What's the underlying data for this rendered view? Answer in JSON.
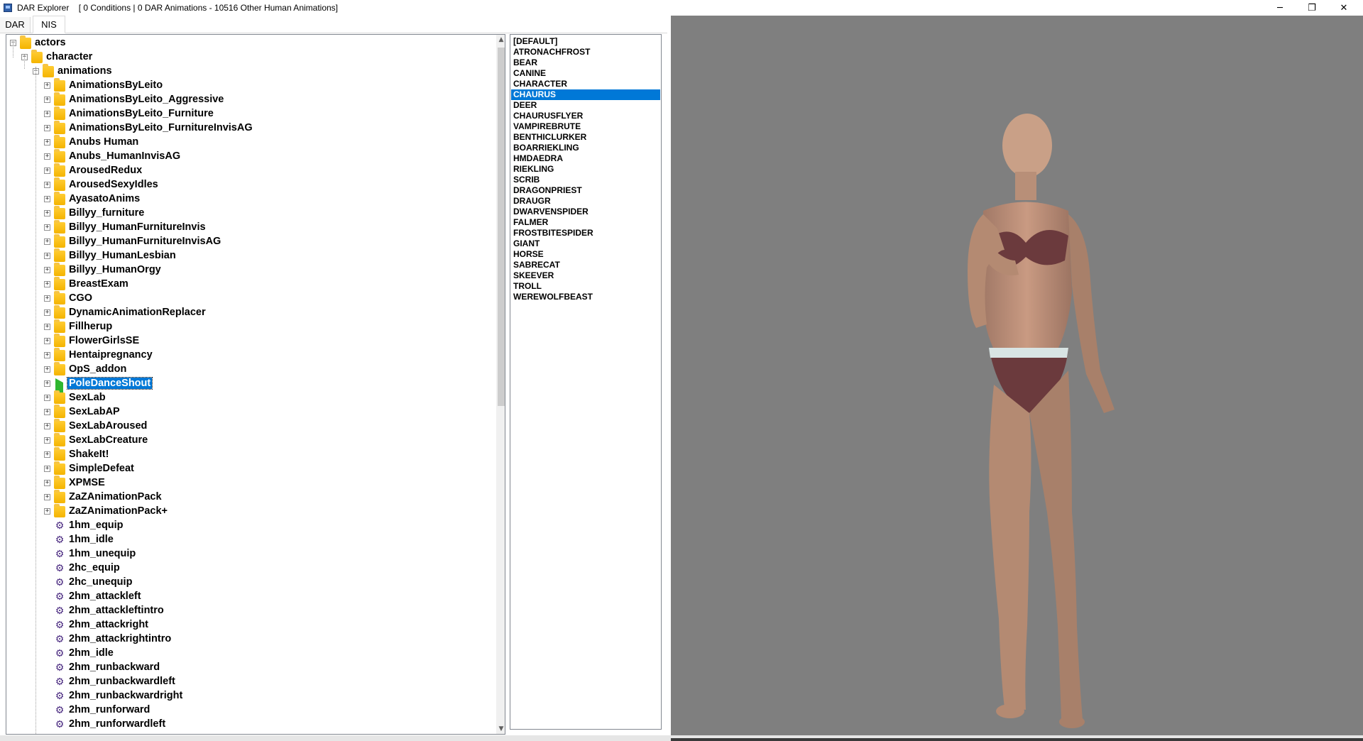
{
  "window": {
    "title": "DAR Explorer",
    "subtitle": "[ 0 Conditions | 0 DAR Animations - 10516 Other Human Animations]",
    "minimize": "─",
    "maximize": "❐",
    "close": "✕"
  },
  "tabs": {
    "dar": "DAR",
    "nis": "NIS"
  },
  "tree": {
    "root": "actors",
    "character": "character",
    "animations": "animations",
    "folders": [
      "AnimationsByLeito",
      "AnimationsByLeito_Aggressive",
      "AnimationsByLeito_Furniture",
      "AnimationsByLeito_FurnitureInvisAG",
      "Anubs Human",
      "Anubs_HumanInvisAG",
      "ArousedRedux",
      "ArousedSexyIdles",
      "AyasatoAnims",
      "Billyy_furniture",
      "Billyy_HumanFurnitureInvis",
      "Billyy_HumanFurnitureInvisAG",
      "Billyy_HumanLesbian",
      "Billyy_HumanOrgy",
      "BreastExam",
      "CGO",
      "DynamicAnimationReplacer",
      "Fillherup",
      "FlowerGirlsSE",
      "Hentaipregnancy",
      "OpS_addon",
      "PoleDanceShout",
      "SexLab",
      "SexLabAP",
      "SexLabAroused",
      "SexLabCreature",
      "ShakeIt!",
      "SimpleDefeat",
      "XPMSE",
      "ZaZAnimationPack",
      "ZaZAnimationPack+"
    ],
    "selected_folder": "PoleDanceShout",
    "files": [
      "1hm_equip",
      "1hm_idle",
      "1hm_unequip",
      "2hc_equip",
      "2hc_unequip",
      "2hm_attackleft",
      "2hm_attackleftintro",
      "2hm_attackright",
      "2hm_attackrightintro",
      "2hm_idle",
      "2hm_runbackward",
      "2hm_runbackwardleft",
      "2hm_runbackwardright",
      "2hm_runforward",
      "2hm_runforwardleft"
    ],
    "expand_minus": "−",
    "expand_plus": "+"
  },
  "creatures": {
    "items": [
      "[DEFAULT]",
      "ATRONACHFROST",
      "BEAR",
      "CANINE",
      "CHARACTER",
      "CHAURUS",
      "DEER",
      "CHAURUSFLYER",
      "VAMPIREBRUTE",
      "BENTHICLURKER",
      "BOARRIEKLING",
      "HMDAEDRA",
      "RIEKLING",
      "SCRIB",
      "DRAGONPRIEST",
      "DRAUGR",
      "DWARVENSPIDER",
      "FALMER",
      "FROSTBITESPIDER",
      "GIANT",
      "HORSE",
      "SABRECAT",
      "SKEEVER",
      "TROLL",
      "WEREWOLFBEAST"
    ],
    "selected": "CHAURUS"
  },
  "icons": {
    "folder": "folder-icon",
    "animation_file": "hkx-file-icon",
    "active": "play-icon"
  },
  "colors": {
    "selection": "#0078d7",
    "viewport_bg": "#7f7f7f",
    "folder": "#f4b400",
    "active_marker": "#2fb62f"
  }
}
